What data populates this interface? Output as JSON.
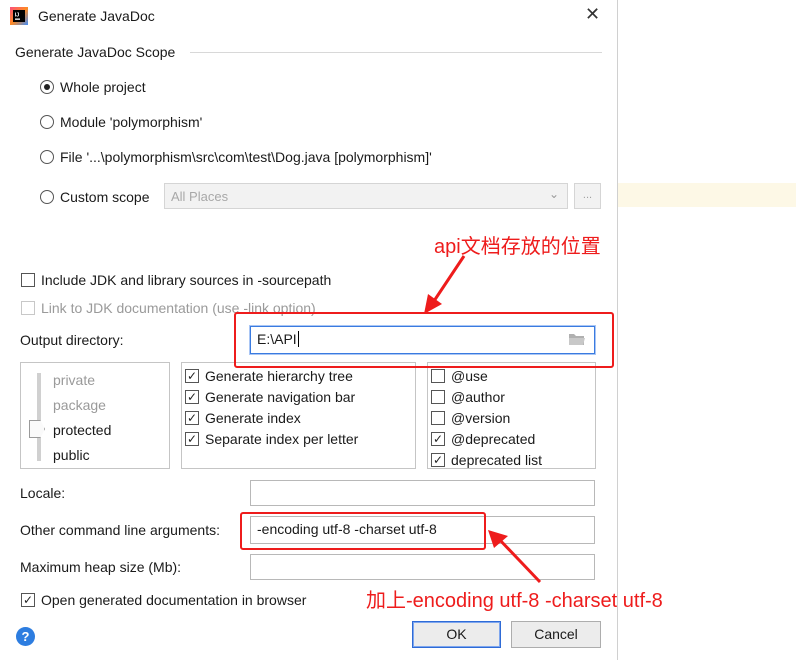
{
  "window": {
    "title": "Generate JavaDoc",
    "close_glyph": "✕"
  },
  "scope": {
    "group_label": "Generate JavaDoc Scope",
    "options": [
      {
        "label": "Whole project",
        "selected": true
      },
      {
        "label": "Module 'polymorphism'",
        "selected": false
      },
      {
        "label": "File '...\\polymorphism\\src\\com\\test\\Dog.java [polymorphism]'",
        "selected": false
      },
      {
        "label": "Custom scope",
        "selected": false
      }
    ],
    "custom_scope_value": "All Places",
    "browse_label": "..."
  },
  "options": {
    "include_jdk": "Include JDK and library sources in -sourcepath",
    "link_jdk": "Link to JDK documentation (use -link option)"
  },
  "output": {
    "label": "Output directory:",
    "value": "E:\\API"
  },
  "visibility": {
    "levels": [
      "private",
      "package",
      "protected",
      "public"
    ],
    "selected": "protected"
  },
  "generate": {
    "items": [
      {
        "label": "Generate hierarchy tree",
        "checked": true
      },
      {
        "label": "Generate navigation bar",
        "checked": true
      },
      {
        "label": "Generate index",
        "checked": true
      },
      {
        "label": "Separate index per letter",
        "checked": true
      }
    ]
  },
  "tags": {
    "items": [
      {
        "label": "@use",
        "checked": false
      },
      {
        "label": "@author",
        "checked": false
      },
      {
        "label": "@version",
        "checked": false
      },
      {
        "label": "@deprecated",
        "checked": true
      },
      {
        "label": "deprecated list",
        "checked": true
      }
    ]
  },
  "fields": {
    "locale_label": "Locale:",
    "locale_value": "",
    "args_label": "Other command line arguments:",
    "args_value": "-encoding utf-8 -charset utf-8",
    "heap_label": "Maximum heap size (Mb):",
    "heap_value": ""
  },
  "open_in_browser": {
    "label": "Open generated documentation in browser",
    "checked": true
  },
  "buttons": {
    "ok": "OK",
    "cancel": "Cancel",
    "help": "?"
  },
  "annotations": {
    "top": "api文档存放的位置",
    "bottom": "加上-encoding utf-8 -charset utf-8"
  },
  "colors": {
    "annotation_red": "#ee1c1c",
    "primary_button_border": "#2f6bd6"
  }
}
